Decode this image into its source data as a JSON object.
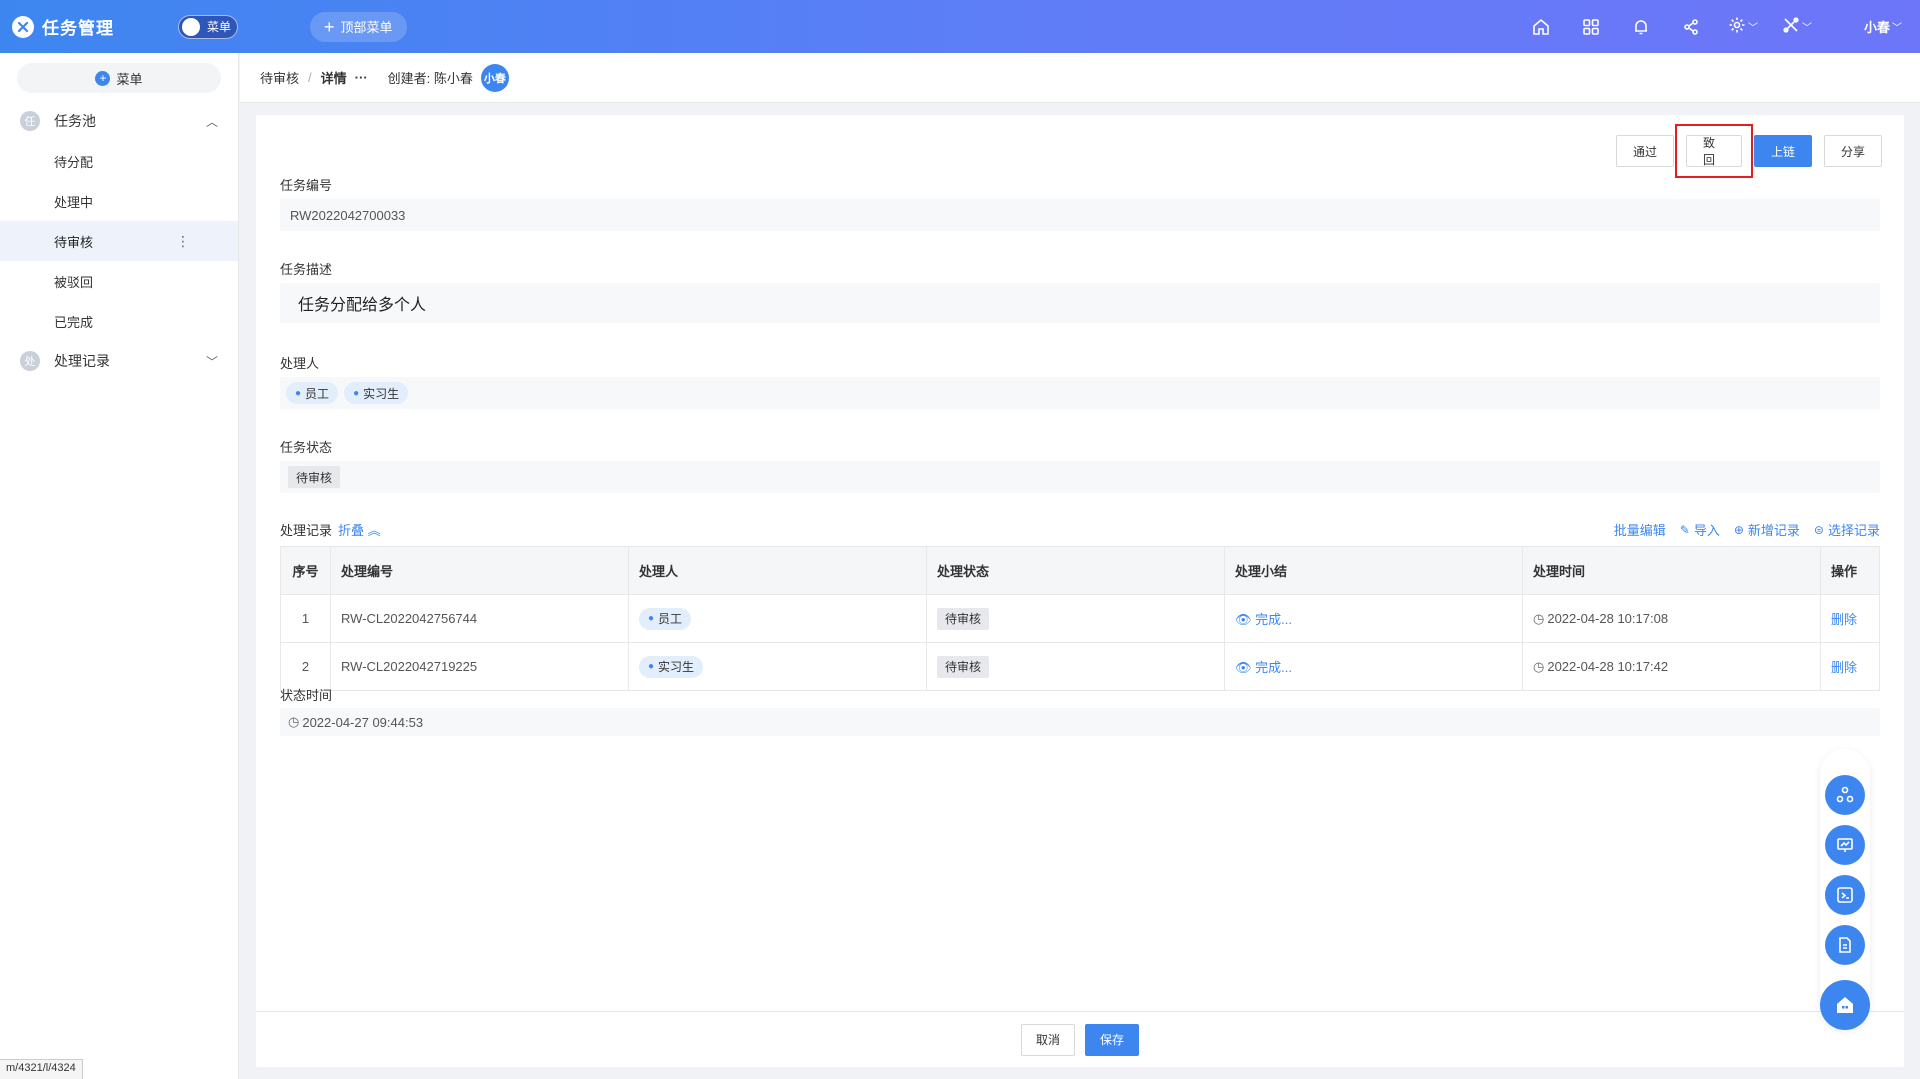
{
  "topbar": {
    "app_title": "任务管理",
    "toggle_label": "菜单",
    "top_menu_label": "顶部菜单",
    "user_name": "小春"
  },
  "sidebar": {
    "menu_button_label": "菜单",
    "groups": [
      {
        "badge": "任",
        "label": "任务池",
        "expanded": true,
        "items": [
          {
            "label": "待分配"
          },
          {
            "label": "处理中"
          },
          {
            "label": "待审核",
            "active": true
          },
          {
            "label": "被驳回"
          },
          {
            "label": "已完成"
          }
        ]
      },
      {
        "badge": "处",
        "label": "处理记录",
        "expanded": false
      }
    ],
    "url_tip": "m/4321/l/4324"
  },
  "breadcrumb": {
    "parent": "待审核",
    "current": "详情",
    "more": "···",
    "creator_label": "创建者: 陈小春",
    "creator_avatar": "小春"
  },
  "actions": {
    "approve": "通过",
    "reject": "致回",
    "onchain": "上链",
    "share": "分享"
  },
  "fields": {
    "task_no_label": "任务编号",
    "task_no_value": "RW2022042700033",
    "desc_label": "任务描述",
    "desc_value": "任务分配给多个人",
    "handler_label": "处理人",
    "handlers": [
      "员工",
      "实习生"
    ],
    "status_label": "任务状态",
    "status_value": "待审核",
    "status_time_label": "状态时间",
    "status_time_value": "2022-04-27 09:44:53"
  },
  "records": {
    "title": "处理记录",
    "collapse_label": "折叠",
    "batch_edit": "批量编辑",
    "import": "导入",
    "add_record": "新增记录",
    "select_record": "选择记录",
    "columns": [
      "序号",
      "处理编号",
      "处理人",
      "处理状态",
      "处理小结",
      "处理时间",
      "操作"
    ],
    "rows": [
      {
        "no": "1",
        "code": "RW-CL2022042756744",
        "handler": "员工",
        "status": "待审核",
        "summary": "完成...",
        "time": "2022-04-28 10:17:08",
        "op": "删除"
      },
      {
        "no": "2",
        "code": "RW-CL2022042719225",
        "handler": "实习生",
        "status": "待审核",
        "summary": "完成...",
        "time": "2022-04-28 10:17:42",
        "op": "删除"
      }
    ]
  },
  "footer": {
    "cancel": "取消",
    "save": "保存"
  },
  "colors": {
    "primary": "#3d86f0",
    "highlight_border": "#e02020"
  }
}
